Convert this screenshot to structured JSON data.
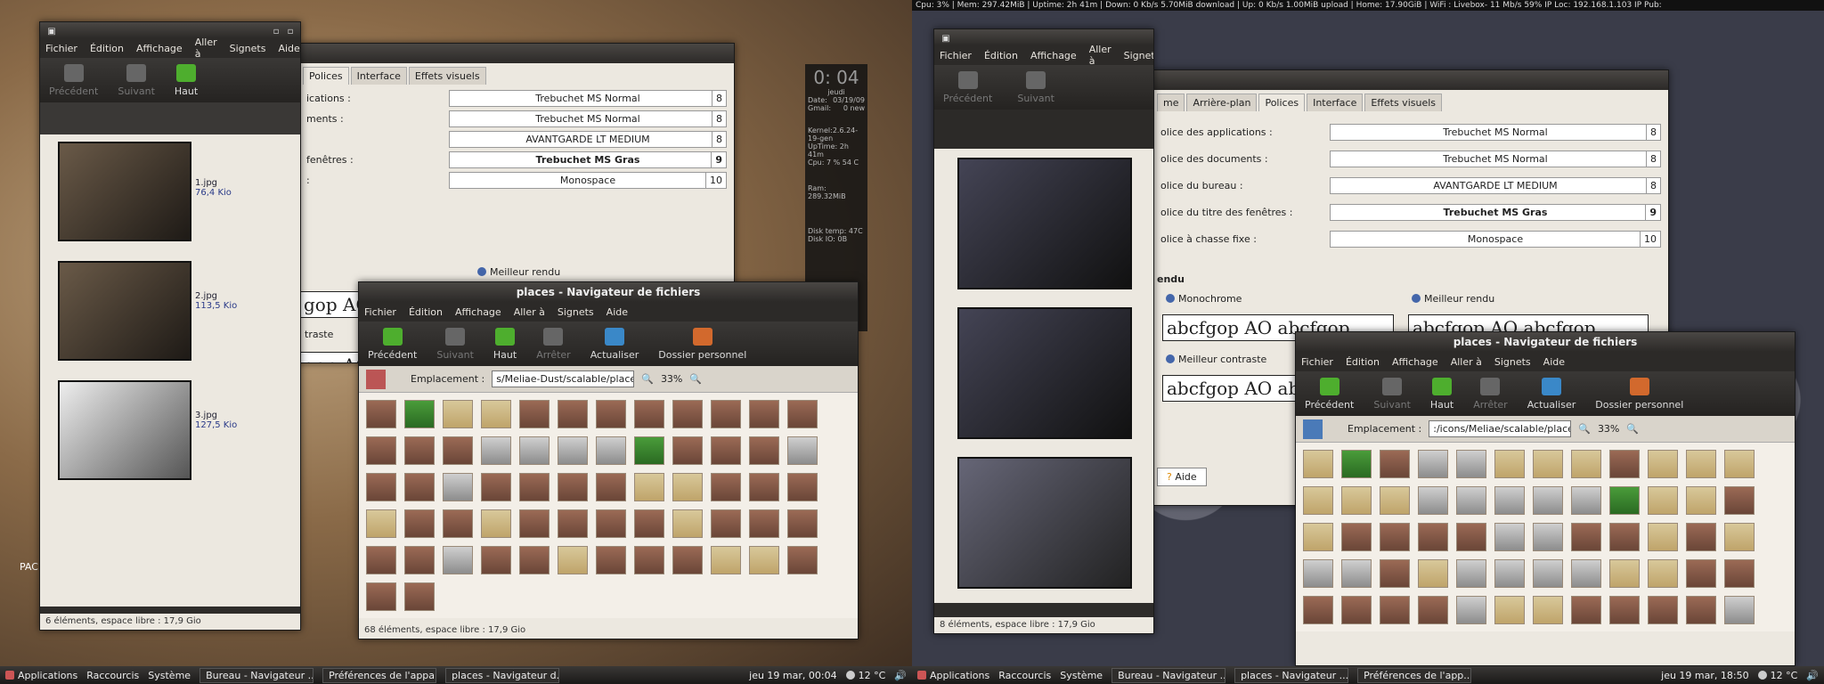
{
  "top_bar": "Cpu: 3% | Mem: 297.42MiB | Uptime: 2h 41m | Down: 0 Kb/s 5.70MiB download | Up: 0 Kb/s 1.00MiB upload | Home: 17.90GiB | WiFi : Livebox- 11 Mb/s 59% IP Loc: 192.168.1.103 IP Pub:",
  "menu": [
    "Fichier",
    "Édition",
    "Affichage",
    "Aller à",
    "Signets",
    "Aide"
  ],
  "tools": {
    "back": "Précédent",
    "forward": "Suivant",
    "up": "Haut",
    "stop": "Arrêter",
    "reload": "Actualiser",
    "home": "Dossier personnel"
  },
  "location_label": "Emplacement :",
  "left": {
    "thumbs_status": "6 éléments, espace libre : 17,9 Gio",
    "thumbs": [
      {
        "name": "1.jpg",
        "size": "76,4 Kio"
      },
      {
        "name": "2.jpg",
        "size": "113,5 Kio"
      },
      {
        "name": "3.jpg",
        "size": "127,5 Kio"
      }
    ],
    "prefs_tabs": [
      "Polices",
      "Interface",
      "Effets visuels"
    ],
    "fonts": [
      {
        "label": "ications :",
        "value": "Trebuchet MS Normal",
        "size": "8"
      },
      {
        "label": "ments :",
        "value": "Trebuchet MS Normal",
        "size": "8"
      },
      {
        "label": "",
        "value": "AVANTGARDE LT MEDIUM",
        "size": "8"
      },
      {
        "label": "fenêtres :",
        "value": "Trebuchet MS Gras",
        "size": "9"
      },
      {
        "label": ":",
        "value": "Monospace",
        "size": "10"
      }
    ],
    "best": "Meilleur rendu",
    "contrast": "traste",
    "sample": "gop AO",
    "places_title": "places - Navigateur de fichiers",
    "loc": "s/Meliae-Dust/scalable/places",
    "zoom": "33%",
    "places_status": "68 éléments, espace libre : 17,9 Gio",
    "conky": {
      "time": "0: 04",
      "day": "jeudi",
      "date_label": "Date:",
      "date": "03/19/09",
      "gmail_label": "Gmail:",
      "gmail": "0 new",
      "kernel": "Kernel:2.6.24-19-gen",
      "uptime": "UpTime: 2h 41m",
      "cpu": "Cpu:  7 % 54 C",
      "ram": "Ram: 289.32MiB",
      "disk": "Disk temp: 47C",
      "disk_io": "Disk IO: 0B"
    },
    "pac": "PAC",
    "panel": {
      "apps": "Applications",
      "places": "Raccourcis",
      "system": "Système",
      "tasks": [
        "Bureau - Navigateur ...",
        "Préférences de l'appa...",
        "places - Navigateur d..."
      ],
      "clock": "jeu 19 mar, 00:04",
      "temp": "12 °C"
    }
  },
  "right": {
    "thumbs_status": "8 éléments, espace libre : 17,9 Gio",
    "prefs_tabs": [
      "me",
      "Arrière-plan",
      "Polices",
      "Interface",
      "Effets visuels"
    ],
    "fonts": [
      {
        "label": "olice des applications :",
        "value": "Trebuchet MS Normal",
        "size": "8"
      },
      {
        "label": "olice des documents :",
        "value": "Trebuchet MS Normal",
        "size": "8"
      },
      {
        "label": "olice du bureau :",
        "value": "AVANTGARDE LT MEDIUM",
        "size": "8"
      },
      {
        "label": "olice du titre des fenêtres :",
        "value": "Trebuchet MS Gras",
        "size": "9"
      },
      {
        "label": "olice à chasse fixe :",
        "value": "Monospace",
        "size": "10"
      }
    ],
    "render": "endu",
    "mono": "Monochrome",
    "best": "Meilleur rendu",
    "contrast": "Meilleur contraste",
    "sample": "abcfgop AO abcfgop",
    "help": "Aide",
    "places_title": "places - Navigateur de fichiers",
    "loc": ":/icons/Meliae/scalable/places",
    "zoom": "33%",
    "panel": {
      "apps": "Applications",
      "places": "Raccourcis",
      "system": "Système",
      "tasks": [
        "Bureau - Navigateur ...",
        "places - Navigateur ...",
        "Préférences de l'app..."
      ],
      "clock": "jeu 19 mar, 18:50",
      "temp": "12 °C"
    }
  }
}
